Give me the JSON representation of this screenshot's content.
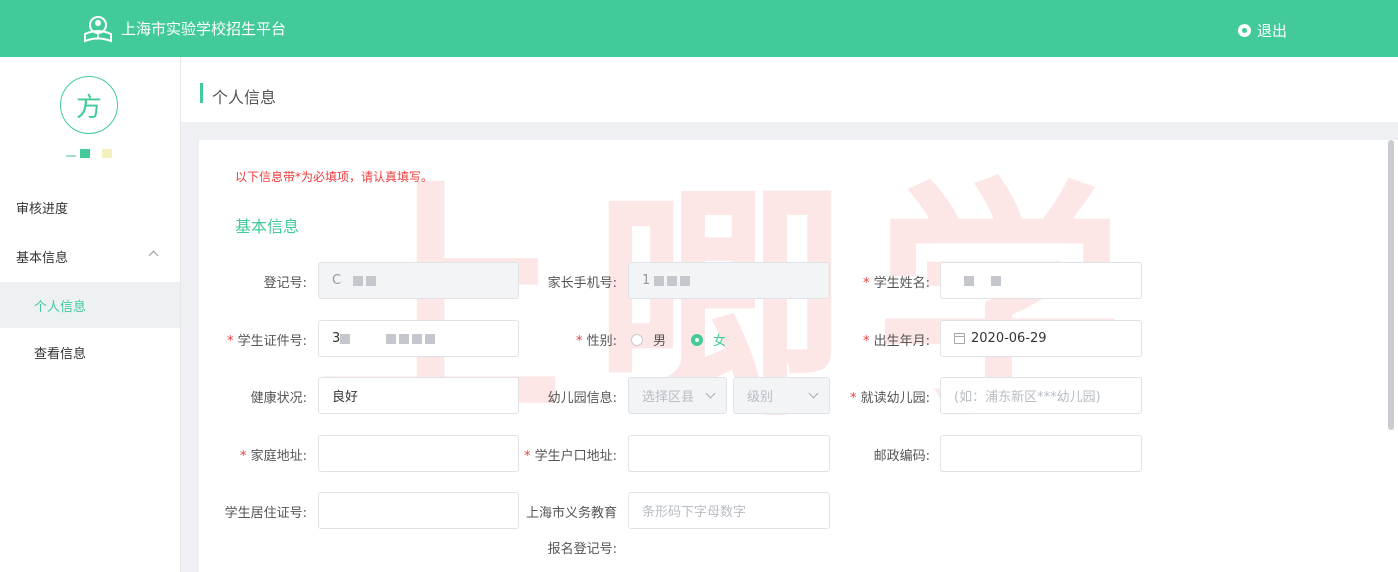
{
  "app": {
    "title": "上海市实验学校招生平台",
    "logout_label": "退出"
  },
  "user": {
    "avatar_char": "方"
  },
  "sidebar": {
    "items": [
      {
        "label": "审核进度"
      },
      {
        "label": "基本信息"
      },
      {
        "label": "个人信息"
      },
      {
        "label": "查看信息"
      }
    ]
  },
  "page": {
    "title": "个人信息",
    "notice": "以下信息带*为必填项，请认真填写。",
    "section_title": "基本信息"
  },
  "form": {
    "reg_no": {
      "label": "登记号:",
      "value": "C"
    },
    "parent_phone": {
      "label": "家长手机号:",
      "value": "1"
    },
    "student_name": {
      "label": "学生姓名:",
      "value": ""
    },
    "student_id": {
      "label": "学生证件号:",
      "value": "3"
    },
    "gender": {
      "label": "性别:",
      "options": [
        "男",
        "女"
      ],
      "selected": "女"
    },
    "birth": {
      "label": "出生年月:",
      "value": "2020-06-29"
    },
    "health": {
      "label": "健康状况:",
      "value": "良好"
    },
    "kindergarten_info": {
      "label": "幼儿园信息:",
      "district_placeholder": "选择区县",
      "level_placeholder": "级别"
    },
    "kindergarten": {
      "label": "就读幼儿园:",
      "placeholder": "(如：浦东新区***幼儿园)"
    },
    "home_address": {
      "label": "家庭地址:",
      "value": ""
    },
    "hukou_address": {
      "label": "学生户口地址:",
      "value": ""
    },
    "postcode": {
      "label": "邮政编码:",
      "value": ""
    },
    "residence_permit": {
      "label": "学生居住证号:",
      "value": ""
    },
    "compulsory_reg": {
      "label_line1": "上海市义务教育",
      "label_line2": "报名登记号:",
      "placeholder": "条形码下字母数字"
    },
    "required_mark": "*"
  },
  "watermark": "上唧学",
  "colors": {
    "accent": "#42cb99",
    "required": "#f03c3c"
  }
}
